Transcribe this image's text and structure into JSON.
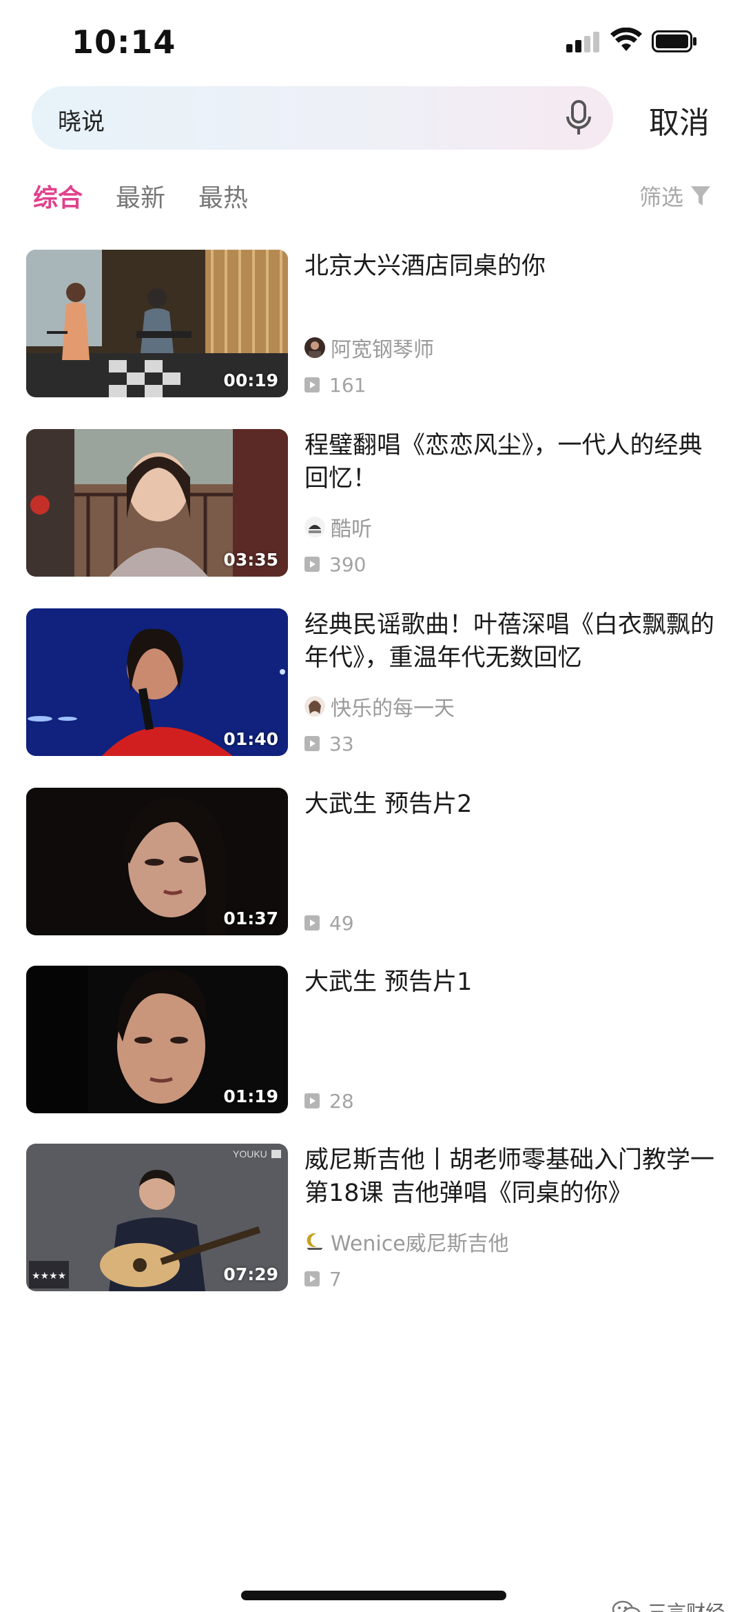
{
  "status_bar": {
    "time": "10:14",
    "signal_level": 2,
    "wifi_icon": "wifi-icon",
    "battery_icon": "battery-icon"
  },
  "search": {
    "query": "晓说",
    "mic_icon": "microphone-icon",
    "cancel_label": "取消"
  },
  "tabs": [
    {
      "label": "综合",
      "active": true
    },
    {
      "label": "最新",
      "active": false
    },
    {
      "label": "最热",
      "active": false
    }
  ],
  "filter": {
    "label": "筛选",
    "icon": "filter-funnel-icon"
  },
  "videos": [
    {
      "title": "北京大兴酒店同桌的你",
      "author": "阿宽钢琴师",
      "views": "161",
      "duration": "00:19"
    },
    {
      "title": "程璧翻唱《恋恋风尘》，一代人的经典回忆！",
      "author": "酷听",
      "views": "390",
      "duration": "03:35"
    },
    {
      "title": "经典民谣歌曲！叶蓓深唱《白衣飘飘的年代》，重温年代无数回忆",
      "author": "快乐的每一天",
      "views": "33",
      "duration": "01:40"
    },
    {
      "title": "大武生 预告片2",
      "author": "",
      "views": "49",
      "duration": "01:37"
    },
    {
      "title": "大武生 预告片1",
      "author": "",
      "views": "28",
      "duration": "01:19"
    },
    {
      "title": "威尼斯吉他丨胡老师零基础入门教学一第18课 吉他弹唱《同桌的你》",
      "author": "Wenice威尼斯吉他",
      "views": "7",
      "duration": "07:29"
    }
  ],
  "watermark": {
    "text": "三言财经",
    "icon": "wechat-icon"
  },
  "colors": {
    "accent": "#e0418c",
    "muted_text": "#9a9a9a"
  }
}
